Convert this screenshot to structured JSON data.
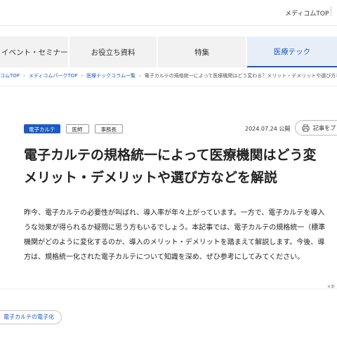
{
  "header": {
    "top_link": "メディコムTOP"
  },
  "nav": {
    "tabs": [
      {
        "label": "イベント・セミナー"
      },
      {
        "label": "お役立ち資料"
      },
      {
        "label": "特集"
      },
      {
        "label": "医療テック"
      }
    ],
    "active_tab": "医療テック",
    "accent_color": "#1a5bc4"
  },
  "breadcrumb": {
    "items": [
      "コムTOP",
      "メディコムパークTOP",
      "医療テックコラム一覧",
      "電子カルテの規格統一によって医療機関はどう変わる？メリット・デメリットや選び方などを解説"
    ],
    "separator": "›"
  },
  "article": {
    "tags": [
      "電子カルテ",
      "医師",
      "事務長"
    ],
    "date": "2024.07.24",
    "date_suffix": "公開",
    "print_label": "記事をプ",
    "print_icon": "printer-icon",
    "title_lines": [
      "電子カルテの規格統一によって医療機関はどう変",
      "メリット・デメリットや選び方などを解説"
    ],
    "lead_lines": [
      "昨今、電子カルテの必要性が叫ばれ、導入率が年々上がっています。一方で、電子カルテを導入",
      "うな効果が得られるか疑問に思う方もいるでしょう。本記事では、電子カルテの規格統一（標準",
      "機関がどのように変化するのか、導入のメリット・デメリットを踏まえて解説します。今後、導",
      "方は、規格統一化された電子カルテについて知識を深め、ぜひ参考にしてみてください。"
    ],
    "note": "※本"
  },
  "related": {
    "chip_label": "電子カルテの電子化"
  }
}
